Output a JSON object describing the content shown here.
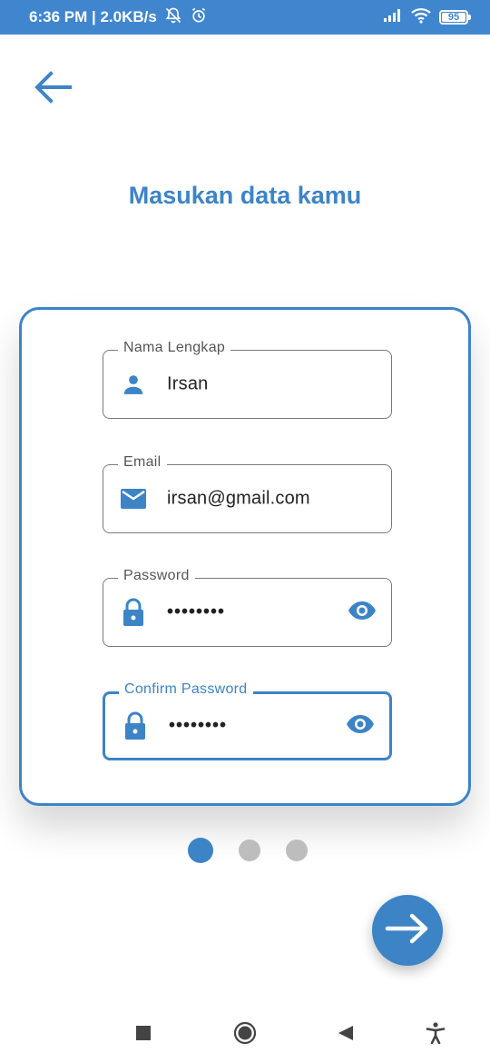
{
  "status_bar": {
    "time_speed": "6:36 PM | 2.0KB/s",
    "battery_level": "95",
    "icons": [
      "alarm-off-icon",
      "alarm-clock-icon",
      "signal-icon",
      "wifi-icon",
      "battery-icon"
    ]
  },
  "header": {
    "back_icon": "arrow-left-icon",
    "title": "Masukan data kamu"
  },
  "form": {
    "fields": [
      {
        "label": "Nama Lengkap",
        "value": "Irsan",
        "icon": "person-icon"
      },
      {
        "label": "Email",
        "value": "irsan@gmail.com",
        "icon": "mail-icon"
      },
      {
        "label": "Password",
        "value": "••••••••",
        "icon": "lock-icon",
        "trailing_icon": "eye-icon"
      },
      {
        "label": "Confirm Password",
        "value": "••••••••",
        "icon": "lock-icon",
        "trailing_icon": "eye-icon",
        "focused": true
      }
    ]
  },
  "pager": {
    "count": 3,
    "active_index": 0
  },
  "next_button": {
    "icon": "arrow-right-icon"
  },
  "nav_bar": {
    "icons": [
      "recents-square-icon",
      "home-circle-icon",
      "back-triangle-icon",
      "accessibility-icon"
    ]
  },
  "colors": {
    "accent": "#3d84c6",
    "status_bar": "#3f86cf",
    "inactive_dot": "#bdbdbd",
    "outline": "#7a7a7a"
  }
}
